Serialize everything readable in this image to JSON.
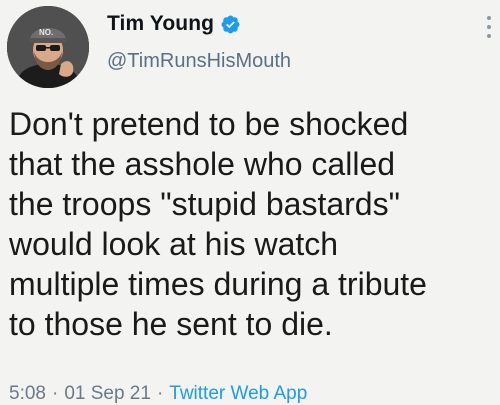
{
  "tweet": {
    "author": {
      "display_name": "Tim Young",
      "handle": "@TimRunsHisMouth",
      "verified": true,
      "avatar_cap_text": "NO."
    },
    "text": "Don't pretend to be shocked\nthat the asshole who called\nthe troops \"stupid bastards\"\nwould look at his watch\nmultiple times during a tribute\nto those he sent to die.",
    "meta": {
      "time": "5:08",
      "date": "01 Sep 21",
      "source": "Twitter Web App",
      "separator": "·"
    },
    "icons": {
      "verified": "verified-badge-icon",
      "more": "more-options-icon"
    },
    "colors": {
      "link": "#1d9bf0",
      "secondary_text": "#5b7083",
      "background": "#f3f3f1"
    }
  }
}
